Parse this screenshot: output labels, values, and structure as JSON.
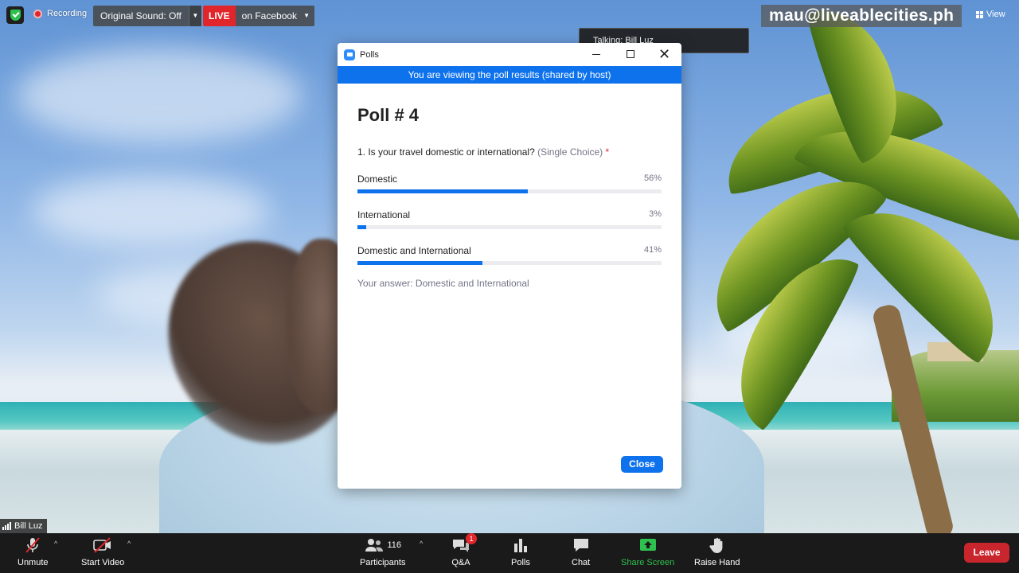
{
  "topbar": {
    "recording_label": "Recording",
    "original_sound_label": "Original Sound: Off",
    "live_badge": "LIVE",
    "live_destination": "on Facebook",
    "email": "mau@liveablecities.ph",
    "view_label": "View"
  },
  "talking_indicator": "Talking: Bill Luz",
  "poll_window": {
    "window_title": "Polls",
    "banner": "You are viewing the poll results (shared by host)",
    "poll_title": "Poll # 4",
    "question_text": "1. Is your travel domestic or international?",
    "question_type": "(Single Choice)",
    "required_marker": "*",
    "options": [
      {
        "label": "Domestic",
        "percent_label": "56%",
        "percent": 56
      },
      {
        "label": "International",
        "percent_label": "3%",
        "percent": 3
      },
      {
        "label": "Domestic and International",
        "percent_label": "41%",
        "percent": 41
      }
    ],
    "your_answer": "Your answer: Domestic and International",
    "close_label": "Close"
  },
  "name_tag": "Bill Luz",
  "toolbar": {
    "unmute": "Unmute",
    "start_video": "Start Video",
    "participants": "Participants",
    "participants_count": "116",
    "qa": "Q&A",
    "qa_badge": "1",
    "polls": "Polls",
    "chat": "Chat",
    "share_screen": "Share Screen",
    "raise_hand": "Raise Hand",
    "leave": "Leave"
  },
  "colors": {
    "accent_blue": "#0e72ed",
    "live_red": "#e0262b",
    "share_green": "#2fc14f",
    "leave_red": "#c9252d"
  },
  "icons": [
    "shield-icon",
    "record-icon",
    "chevron-down-icon",
    "grid-view-icon",
    "zoom-logo-icon",
    "minimize-icon",
    "maximize-icon",
    "close-icon",
    "signal-icon",
    "mic-muted-icon",
    "video-off-icon",
    "participants-icon",
    "qa-icon",
    "polls-icon",
    "chat-icon",
    "share-screen-icon",
    "raise-hand-icon"
  ]
}
